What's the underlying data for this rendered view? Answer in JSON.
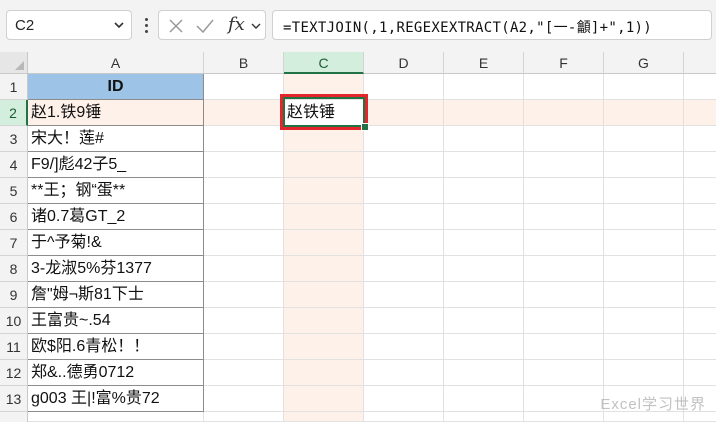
{
  "formula_bar": {
    "name_box": "C2",
    "fx_label": "fx",
    "formula": "=TEXTJOIN(,1,REGEXEXTRACT(A2,\"[一-龥]+\",1))"
  },
  "columns": [
    "A",
    "B",
    "C",
    "D",
    "E",
    "F",
    "G"
  ],
  "rows": [
    "1",
    "2",
    "3",
    "4",
    "5",
    "6",
    "7",
    "8",
    "9",
    "10",
    "11",
    "12",
    "13"
  ],
  "cells": {
    "A": [
      "ID",
      "赵1.铁9锤",
      "宋大！莲#",
      "F9/]彪42子5_",
      "**王；钢“蛋**",
      "诸0.7葛GT_2",
      "于^予菊!&",
      "3-龙淑5%芬1377",
      "詹\"姆¬斯81下士",
      "王富贵~.54",
      "欧$阳.6青松！！",
      "郑&..德勇0712",
      "g003 王|!富%贵72"
    ],
    "C2": "赵铁锤"
  },
  "selection": {
    "cell": "C2",
    "column": "C",
    "row": "2"
  },
  "colors": {
    "header_fill": "#9dc3e6",
    "highlight": "#e3262b",
    "selection": "#217346"
  },
  "watermark": "Excel学习世界"
}
